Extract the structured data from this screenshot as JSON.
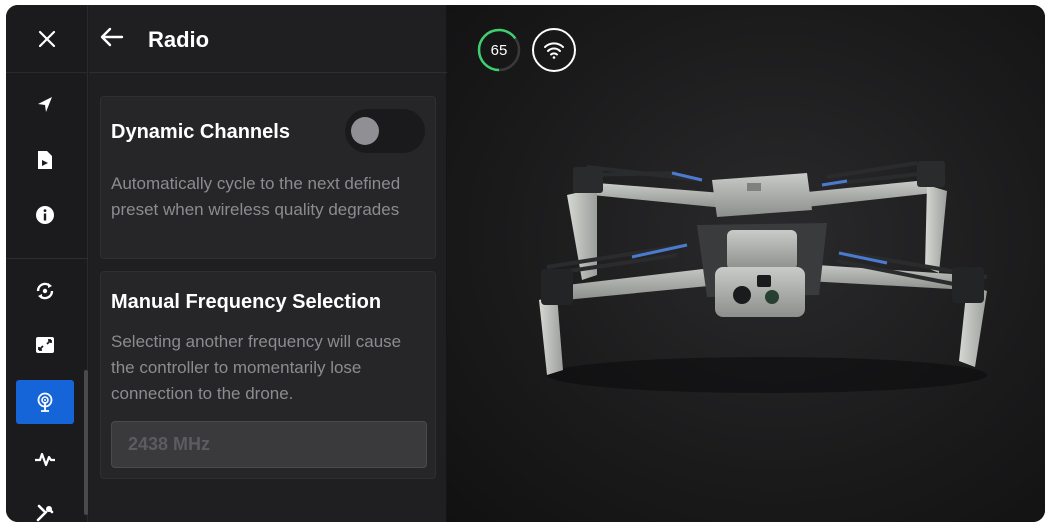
{
  "panel": {
    "title": "Radio"
  },
  "dynamic_channels": {
    "title": "Dynamic Channels",
    "description": "Automatically cycle to the next defined preset when wireless quality degrades",
    "enabled": false
  },
  "manual_frequency": {
    "title": "Manual Frequency Selection",
    "description": "Selecting another frequency will cause the controller to momentarily lose connection to the drone.",
    "value": "2438 MHz"
  },
  "status": {
    "battery_level": "65",
    "battery_fraction": 0.65
  },
  "rail": {
    "items": [
      {
        "icon": "location-arrow-icon"
      },
      {
        "icon": "media-file-icon"
      },
      {
        "icon": "info-icon"
      },
      {
        "icon": "sync-icon"
      },
      {
        "icon": "aspect-ratio-icon"
      },
      {
        "icon": "radio-tower-icon",
        "active": true
      },
      {
        "icon": "activity-icon"
      },
      {
        "icon": "tools-icon"
      }
    ]
  },
  "colors": {
    "accent": "#1565d8",
    "battery_ring": "#3ecf6e"
  }
}
